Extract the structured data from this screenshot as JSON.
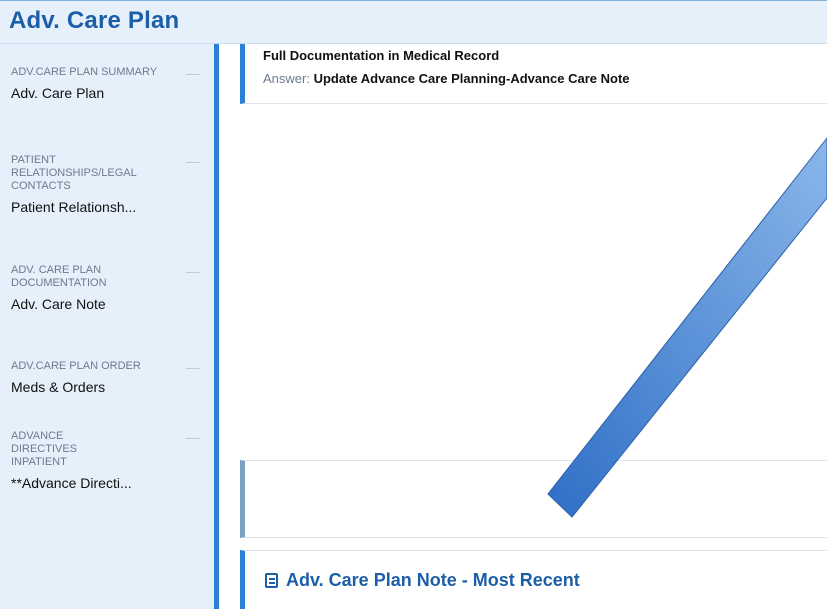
{
  "window": {
    "title": "Adv. Care Plan"
  },
  "sidebar": {
    "sections": [
      {
        "header": "Adv.Care Plan Summary",
        "item": "Adv. Care Plan"
      },
      {
        "header": "Patient Relationships/Legal Contacts",
        "item": "Patient Relationsh..."
      },
      {
        "header": "Adv. Care Plan Documentation",
        "item": "Adv. Care Note"
      },
      {
        "header": "Adv.Care Plan Order",
        "item": "Meds & Orders"
      },
      {
        "header": "Advance Directives Inpatient",
        "item": "**Advance Directi..."
      }
    ]
  },
  "main": {
    "question": {
      "documentation": "Full Documentation in Medical Record",
      "answer_label": "Answer:",
      "answer_value": "Update Advance Care Planning-Advance Care Note"
    },
    "note_card": {
      "icon": "note-icon",
      "title": "Adv. Care Plan Note - Most Recent"
    }
  },
  "annotation": {
    "icon": "arrow-pointer",
    "color": "#3b7cd0"
  }
}
